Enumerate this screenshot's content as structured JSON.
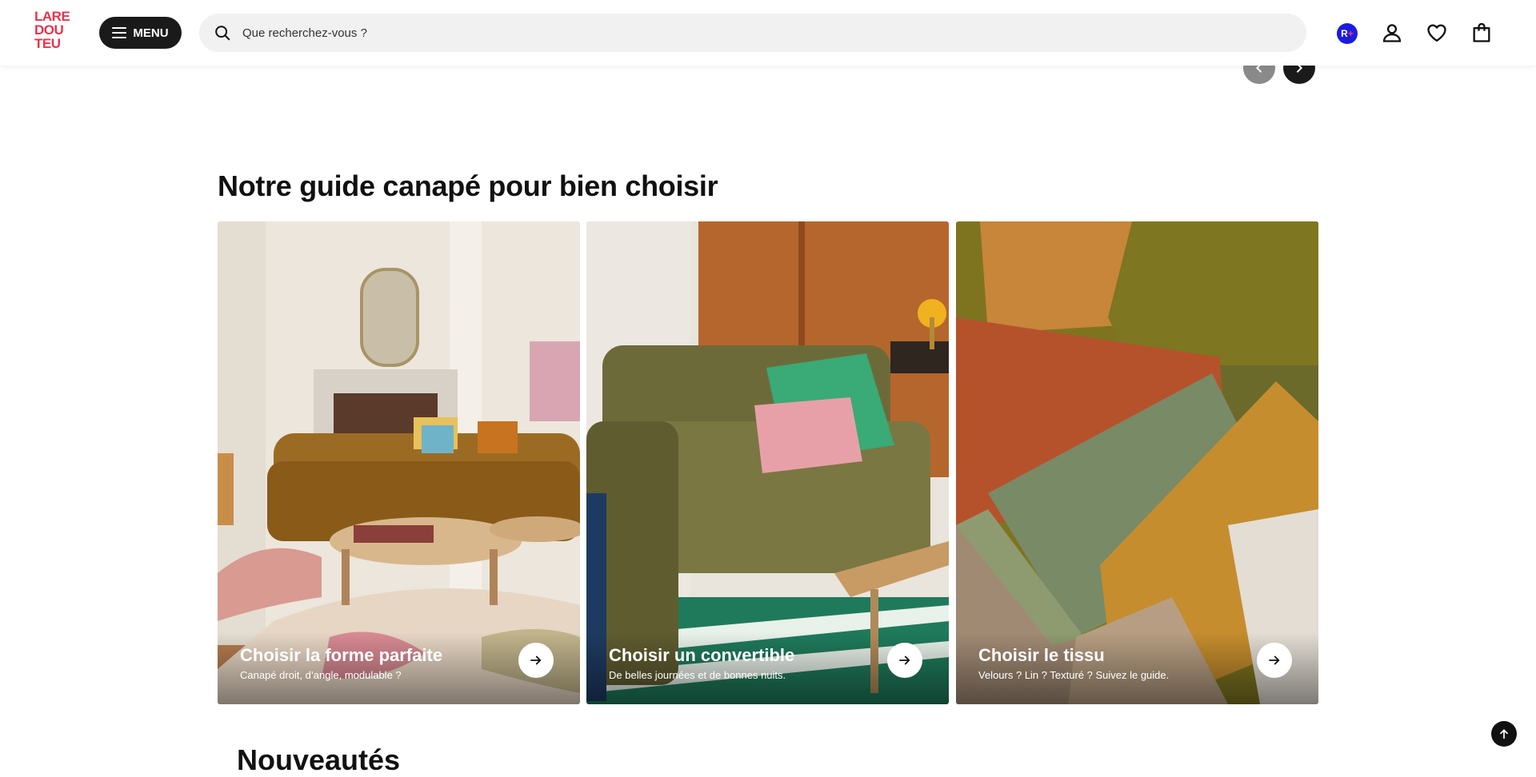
{
  "header": {
    "logo_lines": [
      "LARE",
      "DOU",
      "TEU"
    ],
    "menu_label": "MENU",
    "search_placeholder": "Que recherchez-vous ?",
    "rplus_label": "R",
    "rplus_plus": "+"
  },
  "guide": {
    "title": "Notre guide canapé pour bien choisir",
    "cards": [
      {
        "title": "Choisir la forme parfaite",
        "subtitle": "Canapé droit, d’angle, modulable ?"
      },
      {
        "title": "Choisir un convertible",
        "subtitle": "De belles journées et de bonnes nuits."
      },
      {
        "title": "Choisir le tissu",
        "subtitle": "Velours ? Lin ? Texturé ? Suivez le guide."
      }
    ]
  },
  "next_section": {
    "title": "Nouveautés"
  },
  "colors": {
    "brand": "#e6354d",
    "dark": "#1a1a1a",
    "rplus": "#1b1be0"
  },
  "icons": [
    "menu-icon",
    "search-icon",
    "user-icon",
    "heart-icon",
    "bag-icon",
    "chevron-left-icon",
    "chevron-right-icon",
    "arrow-right-icon",
    "arrow-up-icon"
  ]
}
